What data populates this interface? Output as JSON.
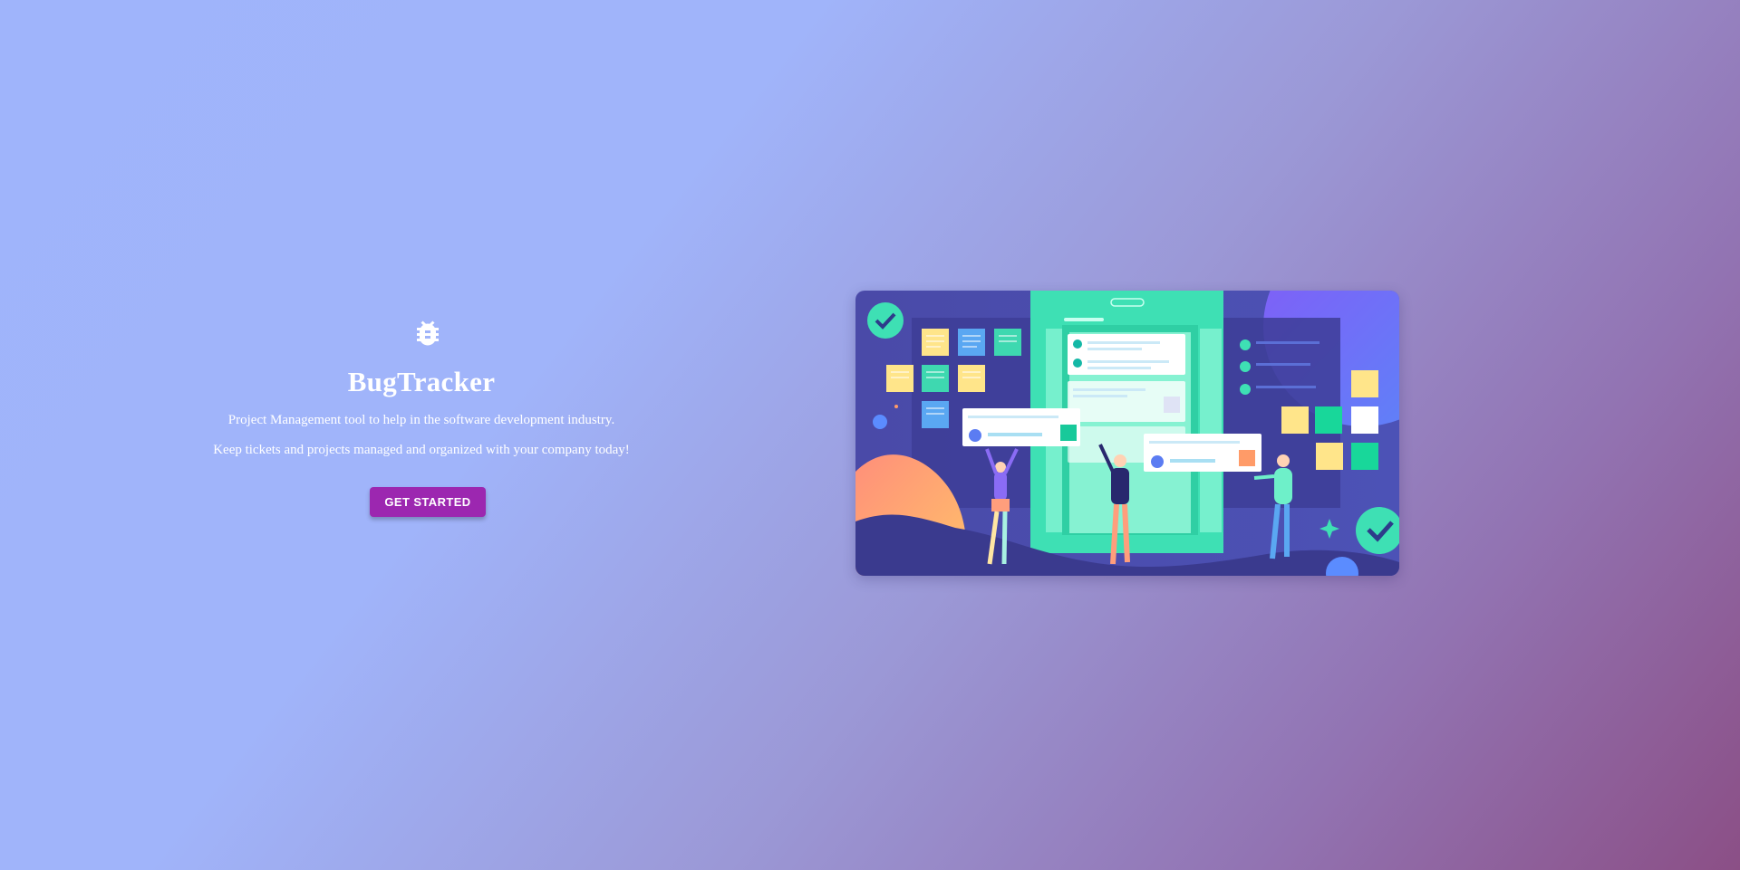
{
  "hero": {
    "icon": "bug-icon",
    "title": "BugTracker",
    "tagline_1": "Project Management tool to help in the software development industry.",
    "tagline_2": "Keep tickets and projects managed and organized with your company today!",
    "cta_label": "GET STARTED"
  },
  "illustration": {
    "icon": "team-kanban-illustration"
  },
  "colors": {
    "accent": "#9c27b0",
    "teal": "#3ee0b4",
    "navy": "#3f3f9a"
  }
}
